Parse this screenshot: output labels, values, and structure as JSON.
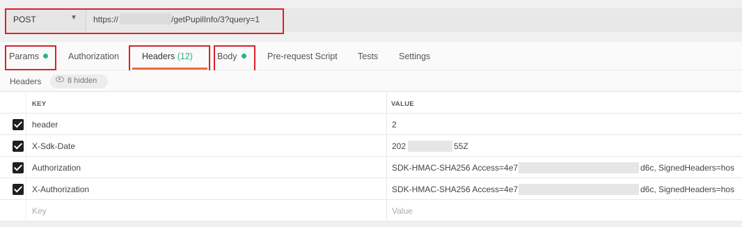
{
  "request": {
    "method": "POST",
    "url_prefix": "https://",
    "url_suffix": "/getPupilInfo/3?query=1"
  },
  "tabs": [
    {
      "label": "Params"
    },
    {
      "label": "Authorization"
    },
    {
      "label": "Headers",
      "count": "(12)"
    },
    {
      "label": "Body"
    },
    {
      "label": "Pre-request Script"
    },
    {
      "label": "Tests"
    },
    {
      "label": "Settings"
    }
  ],
  "headers_section": {
    "title": "Headers",
    "hidden_label": "8 hidden"
  },
  "table": {
    "columns": [
      "KEY",
      "VALUE"
    ],
    "rows": [
      {
        "key": "header",
        "value": "2"
      },
      {
        "key": "X-Sdk-Date",
        "value_start": "202",
        "value_end": "55Z"
      },
      {
        "key": "Authorization",
        "value_start": "SDK-HMAC-SHA256 Access=4e7",
        "value_end": "d6c, SignedHeaders=hos"
      },
      {
        "key": "X-Authorization",
        "value_start": "SDK-HMAC-SHA256 Access=4e7",
        "value_end": "d6c, SignedHeaders=hos"
      }
    ],
    "new_row": {
      "key_placeholder": "Key",
      "value_placeholder": "Value"
    }
  },
  "colors": {
    "accent_orange": "#f26b3a",
    "status_green": "#26b47f",
    "highlight_red": "#d7212a"
  }
}
